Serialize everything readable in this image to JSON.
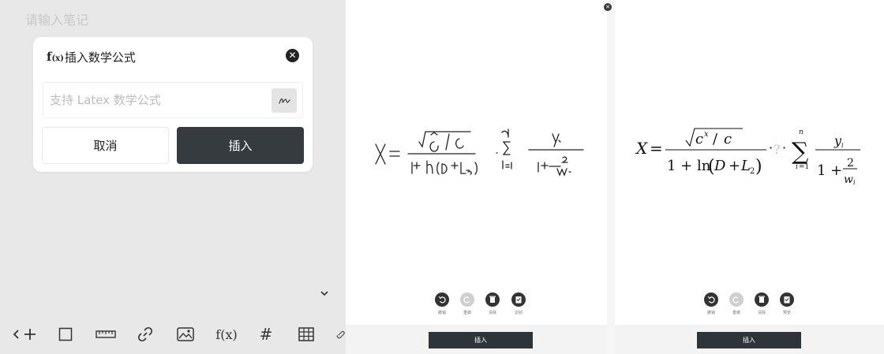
{
  "editor": {
    "note_placeholder": "请输入笔记"
  },
  "modal": {
    "title_icon": "f(x)",
    "title": "插入数学公式",
    "input_placeholder": "支持 Latex 数学公式",
    "cancel_label": "取消",
    "insert_label": "插入"
  },
  "toolbar": {
    "items": [
      "back-icon",
      "add-icon",
      "square-icon",
      "ruler-icon",
      "link-icon",
      "image-icon",
      "function-icon",
      "hash-icon",
      "table-icon",
      "attachment-icon"
    ],
    "fx_label": "f(x)",
    "hash_label": "#"
  },
  "handwriting_panel": {
    "actions": [
      "撤销",
      "重做",
      "清除",
      "识别"
    ],
    "insert_label": "插入"
  },
  "preview_panel": {
    "actions": [
      "撤销",
      "重做",
      "清除",
      "预览"
    ],
    "insert_label": "插入"
  },
  "colors": {
    "dark_button": "#363b3f",
    "background": "#e8e8e8",
    "panel": "#ffffff"
  }
}
